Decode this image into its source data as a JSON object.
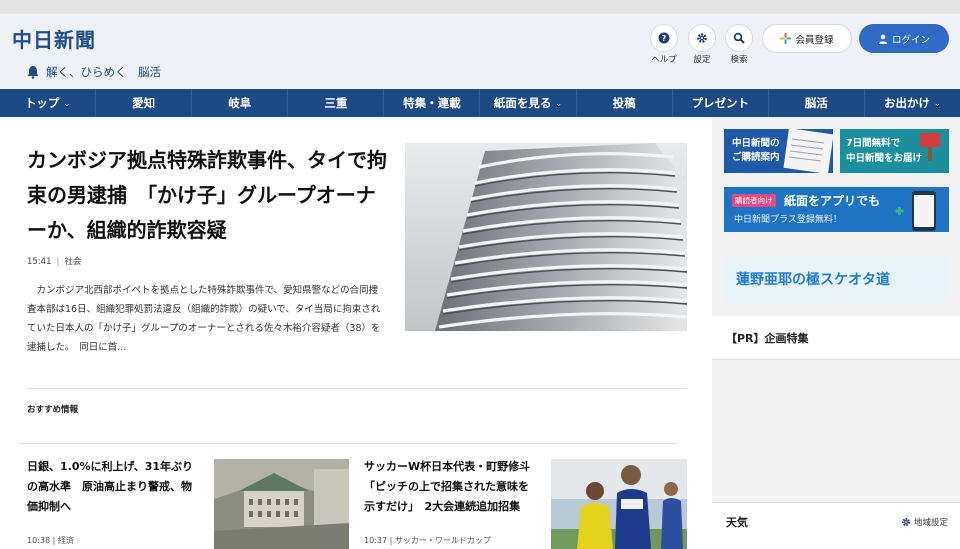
{
  "header": {
    "logo": "中日新聞",
    "tagline": "解く、ひらめく　脳活",
    "icons": [
      {
        "name": "help-icon",
        "label": "ヘルプ"
      },
      {
        "name": "settings-icon",
        "label": "設定"
      },
      {
        "name": "search-icon",
        "label": "検索"
      }
    ],
    "member_label": "会員登録",
    "login_label": "ログイン"
  },
  "nav": {
    "items": [
      {
        "label": "トップ",
        "chevron": true
      },
      {
        "label": "愛知",
        "chevron": false
      },
      {
        "label": "岐阜",
        "chevron": false
      },
      {
        "label": "三重",
        "chevron": false
      },
      {
        "label": "特集・連載",
        "chevron": false
      },
      {
        "label": "紙面を見る",
        "chevron": true
      },
      {
        "label": "投稿",
        "chevron": false
      },
      {
        "label": "プレゼント",
        "chevron": false
      },
      {
        "label": "脳活",
        "chevron": false
      },
      {
        "label": "お出かけ",
        "chevron": true
      }
    ]
  },
  "main": {
    "headline": "カンボジア拠点特殊詐欺事件、タイで拘束の男逮捕　「かけ子」グループオーナーか、組織的詐欺容疑",
    "time": "15:41",
    "category": "社会",
    "summary": "カンボジア北西部ポイペトを拠点とした特殊詐欺事件で、愛知県警などの合同捜査本部は16日、組織犯罪処罰法違反（組織的詐欺）の疑いで、タイ当局に拘束されていた日本人の「かけ子」グループのオーナーとされる佐々木裕介容疑者（38）を逮捕した。　同日に首...",
    "recommended_title": "おすすめ情報",
    "cards": [
      {
        "title": "日銀、1.0%に利上げ、31年ぶりの高水準　原油高止まり警戒、物価抑制へ",
        "time": "10:38",
        "category": "経済"
      },
      {
        "title": "サッカーW杯日本代表・町野修斗「ピッチの上で招集された意味を示すだけ」　2大会連続追加招集",
        "time": "10:37",
        "category": "サッカー・ワールドカップ"
      }
    ]
  },
  "sidebar": {
    "banners": [
      {
        "text": "中日新聞の\nご購読案内"
      },
      {
        "text": "7日間無料で\n中日新聞をお届け"
      },
      {
        "tag": "購読者向け",
        "text": "紙面をアプリでも",
        "sub": "中日新聞プラス登録無料！"
      },
      {
        "text": "蓮野亜耶の極スケオタ道"
      }
    ],
    "pr_title": "【PR】企画特集",
    "weather_title": "天気",
    "region_label": "地域設定"
  },
  "colors": {
    "brand": "#1f4e8c",
    "nav_bg": "#1c4a86",
    "login_bg": "#2f6ac6"
  }
}
